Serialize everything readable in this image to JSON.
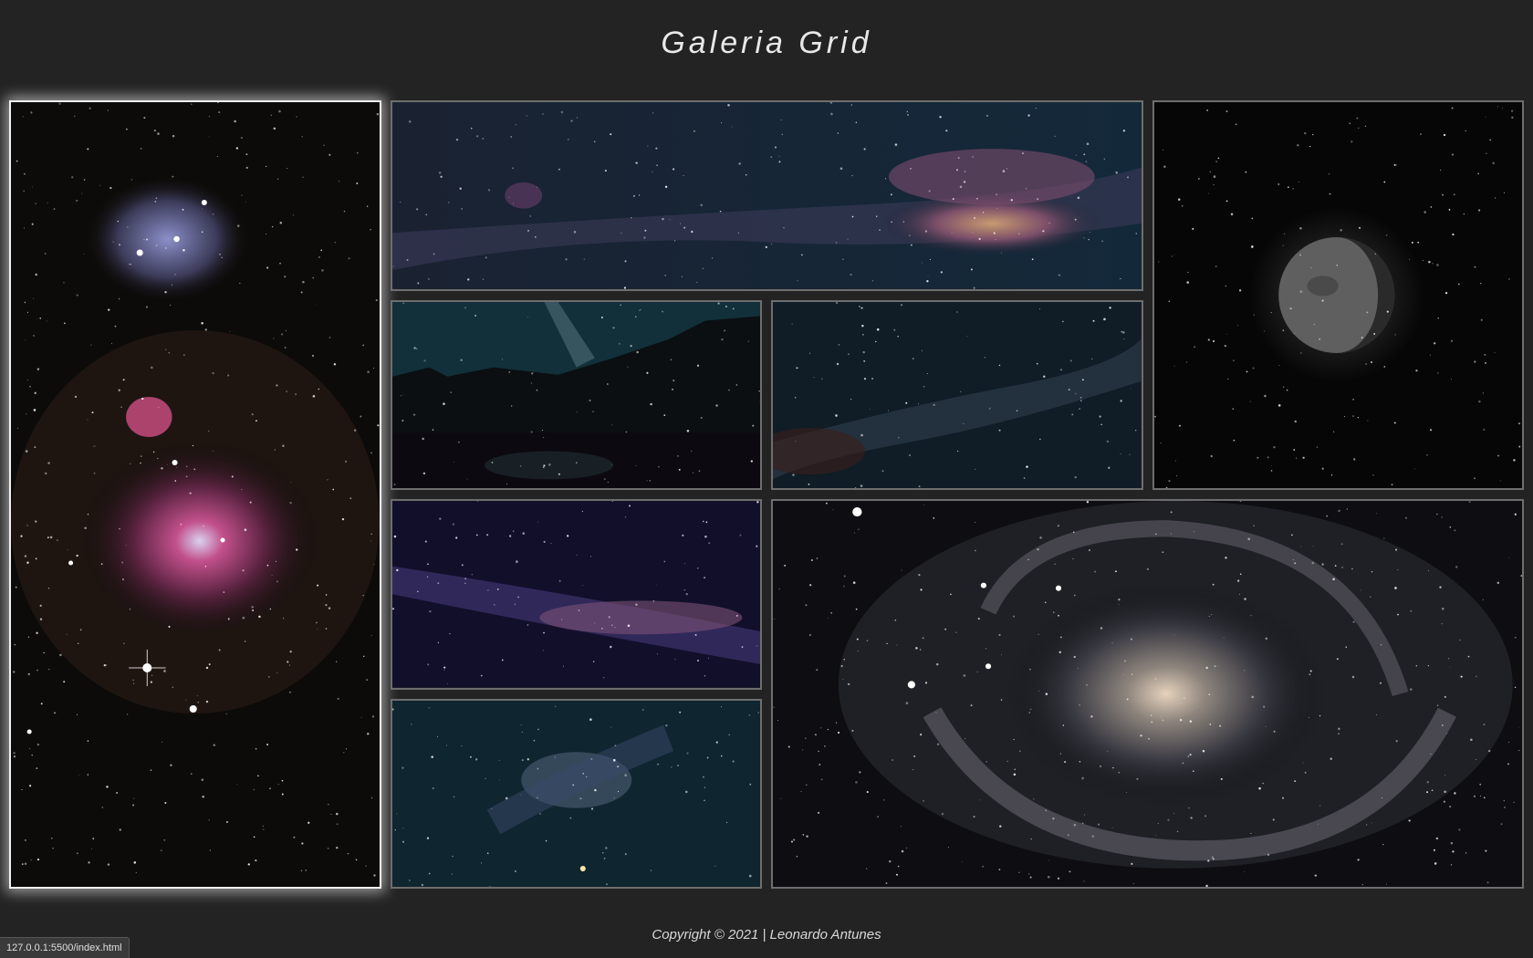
{
  "page": {
    "title": "Galeria Grid",
    "footer": "Copyright © 2021 | Leonardo Antunes"
  },
  "browser": {
    "status_url": "127.0.0.1:5500/index.html"
  },
  "gallery": {
    "active_tile": 1,
    "tiles": [
      {
        "subject": "orion-nebula"
      },
      {
        "subject": "milky-way-panorama"
      },
      {
        "subject": "moon"
      },
      {
        "subject": "milky-way-over-forest-lake"
      },
      {
        "subject": "milky-way-starfield"
      },
      {
        "subject": "purple-milky-way"
      },
      {
        "subject": "barred-spiral-galaxy"
      },
      {
        "subject": "teal-night-sky"
      }
    ]
  },
  "colors": {
    "background": "#232323",
    "tile_border": "#6e6e6e",
    "active_border": "#f2f2f2",
    "text": "#ececec"
  }
}
